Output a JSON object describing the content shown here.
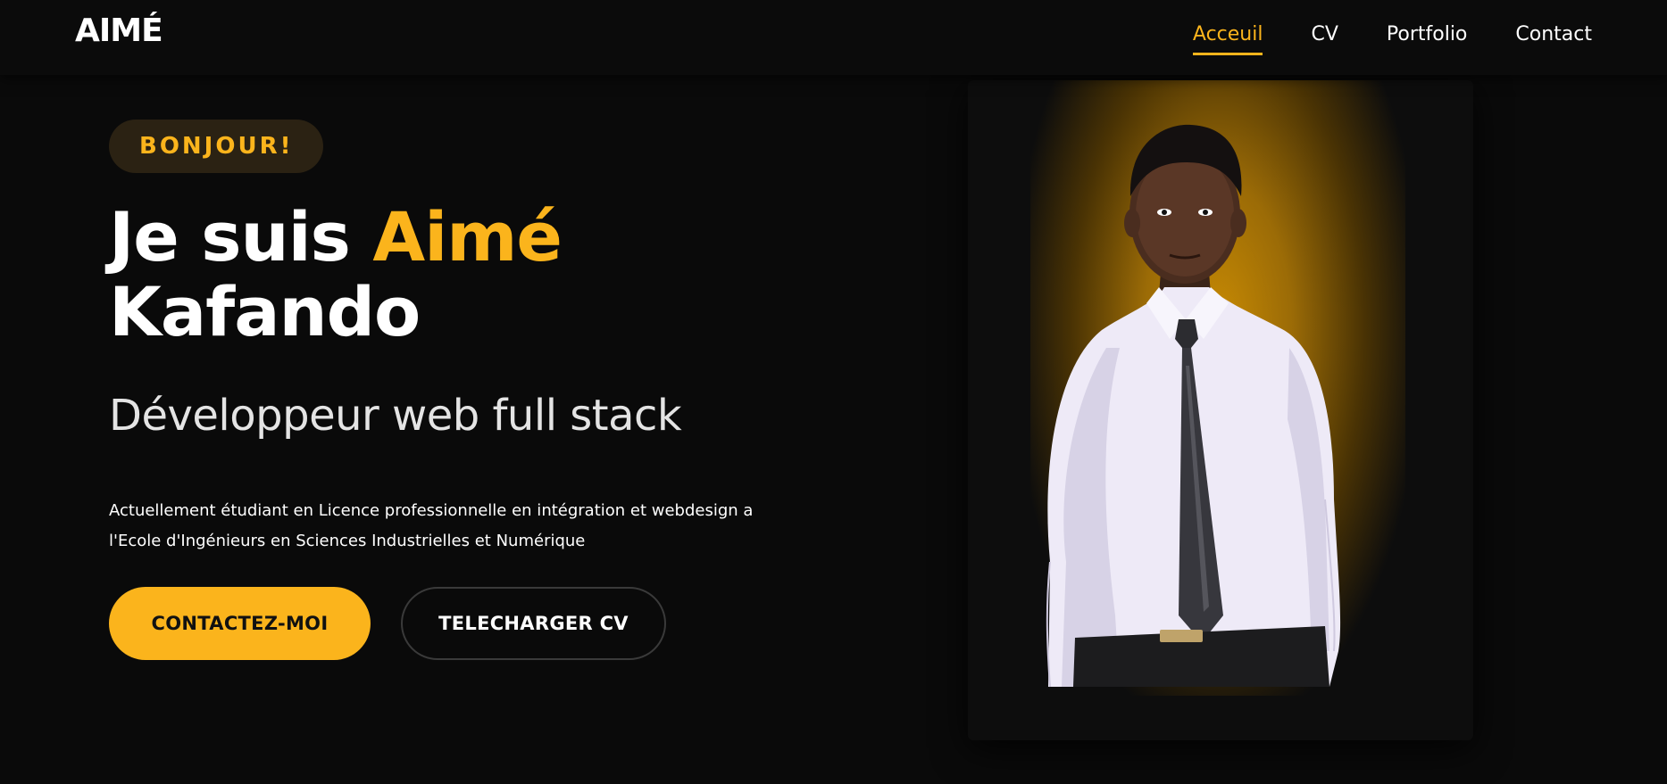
{
  "brand": {
    "logo": "AIMÉ"
  },
  "nav": {
    "items": [
      {
        "label": "Acceuil",
        "active": true
      },
      {
        "label": "CV",
        "active": false
      },
      {
        "label": "Portfolio",
        "active": false
      },
      {
        "label": "Contact",
        "active": false
      }
    ]
  },
  "hero": {
    "badge": "BONJOUR!",
    "headline_prefix": "Je suis ",
    "headline_accent": "Aimé",
    "headline_suffix": "Kafando",
    "role": "Développeur web full stack",
    "description": "Actuellement étudiant en Licence professionnelle en intégration et webdesign a l'Ecole d'Ingénieurs en Sciences Industrielles et Numérique",
    "primary_button": "CONTACTEZ-MOI",
    "secondary_button": "TELECHARGER CV"
  },
  "colors": {
    "accent": "#fbb41c",
    "background": "#0a0a0a",
    "badge_bg": "#2b2213"
  },
  "portrait": {
    "shirt": "white dress shirt",
    "tie": "dark striped tie",
    "glow": "amber"
  }
}
